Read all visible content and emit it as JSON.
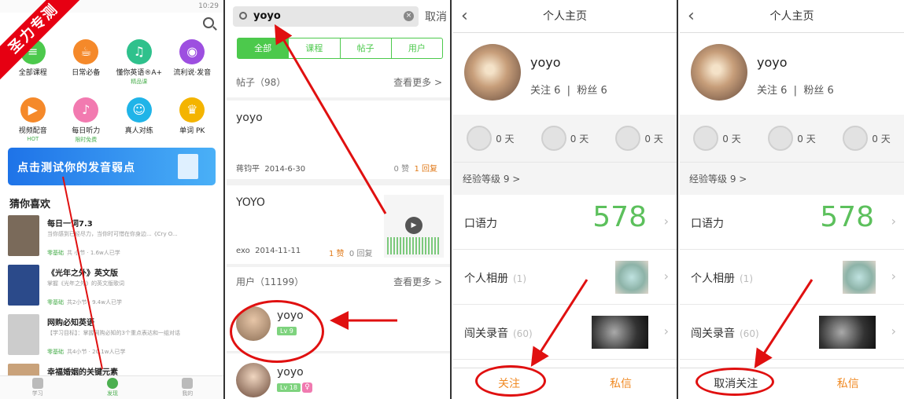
{
  "p1": {
    "status_time": "10:29",
    "corner_label": "圣力专测",
    "categories": [
      {
        "label": "全部课程",
        "sub": "",
        "color": "#4cc94c"
      },
      {
        "label": "日常必备",
        "sub": "",
        "color": "#f5892a"
      },
      {
        "label": "懂你英语®A+",
        "sub": "精品课",
        "color": "#2fc18c"
      },
      {
        "label": "流利说·发音",
        "sub": "",
        "color": "#9d4fe0"
      },
      {
        "label": "视频配音",
        "sub": "HOT",
        "color": "#f5892a"
      },
      {
        "label": "每日听力",
        "sub": "限时免费",
        "color": "#f27ab0"
      },
      {
        "label": "真人对练",
        "sub": "",
        "color": "#20b4e8"
      },
      {
        "label": "单词 PK",
        "sub": "",
        "color": "#f4b400"
      }
    ],
    "banner": "点击测试你的发音弱点",
    "section_title": "猜你喜欢",
    "courses": [
      {
        "title": "每日一词7.3",
        "desc": "当你感到已经尽力，当你时可惜在你身边...《Cry O...",
        "level": "零基础",
        "meta": "共 小节 · 1.6w人已学",
        "color": "#7a6a5a"
      },
      {
        "title": "《光年之外》英文版",
        "desc": "掌握《光年之外》的英文版歌词",
        "level": "零基础",
        "meta": "共2小节 · 9.4w人已学",
        "color": "#2b4a8a"
      },
      {
        "title": "网购必知英语",
        "desc": "【学习目标】：掌握网购必知的3个重点表达和一组对话",
        "level": "零基础",
        "meta": "共4小节 · 20.1w人已学",
        "color": "#ddd"
      },
      {
        "title": "幸福婚姻的关键元素",
        "desc": "",
        "level": "",
        "meta": "",
        "color": "#c9a27a"
      }
    ],
    "tabs": [
      "学习",
      "发现",
      "我的"
    ]
  },
  "p2": {
    "query": "yoyo",
    "cancel": "取消",
    "tabs": [
      "全部",
      "课程",
      "帖子",
      "用户"
    ],
    "posts_header": "帖子（98）",
    "more": "查看更多 >",
    "post1": {
      "title": "yoyo",
      "author": "蒋钧平",
      "date": "2014-6-30",
      "likes": "0 赞",
      "replies": "1 回复"
    },
    "post2": {
      "title": "YOYO",
      "author": "exo",
      "date": "2014-11-11",
      "likes": "1 赞",
      "replies": "0 回复"
    },
    "users_header": "用户（11199）",
    "user1": {
      "name": "yoyo",
      "level": "Lv 9"
    },
    "user2": {
      "name": "yoyo",
      "level": "Lv 18"
    }
  },
  "profile": {
    "title": "个人主页",
    "name": "yoyo",
    "follows": "关注 6",
    "fans": "粉丝 6",
    "badge_days": [
      "0 天",
      "0 天",
      "0 天"
    ],
    "level": "经验等级 9 >",
    "oral": "口语力",
    "score": "578",
    "album": "个人相册",
    "album_count": "(1)",
    "record": "闯关录音",
    "record_count": "(60)",
    "message": "私信"
  },
  "p3_follow": "关注",
  "p4_follow": "取消关注",
  "colors": {
    "green": "#4cc94c",
    "red": "#e01010",
    "orange": "#f08a24"
  }
}
